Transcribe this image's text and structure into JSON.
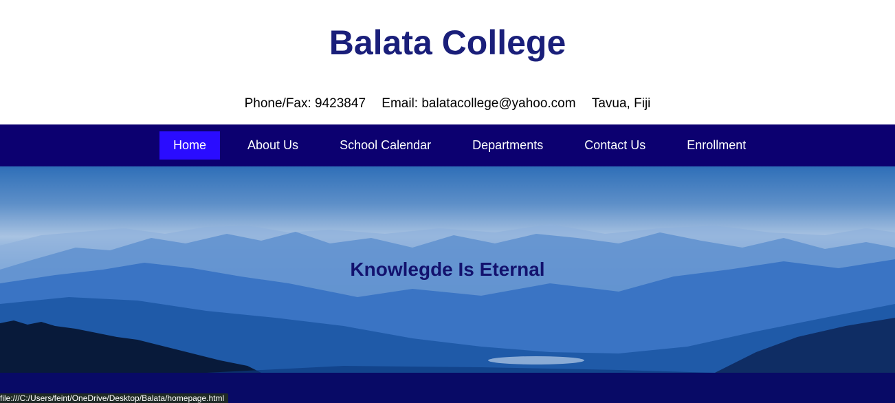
{
  "header": {
    "title": "Balata College",
    "phone": "Phone/Fax: 9423847",
    "email": "Email: balatacollege@yahoo.com",
    "location": "Tavua, Fiji"
  },
  "nav": {
    "items": [
      {
        "label": "Home",
        "active": true
      },
      {
        "label": "About Us"
      },
      {
        "label": "School Calendar"
      },
      {
        "label": "Departments"
      },
      {
        "label": "Contact Us"
      },
      {
        "label": "Enrollment"
      }
    ]
  },
  "hero": {
    "tagline": "Knowlegde Is Eternal"
  },
  "content": {
    "intro": ""
  },
  "status_bar": {
    "url": "file:///C:/Users/feint/OneDrive/Desktop/Balata/homepage.html"
  },
  "colors": {
    "title": "#1a1f7a",
    "navbar": "#0c0070",
    "nav_active": "#2a0cff",
    "tagline": "#13126e",
    "body_band": "#080a66"
  }
}
